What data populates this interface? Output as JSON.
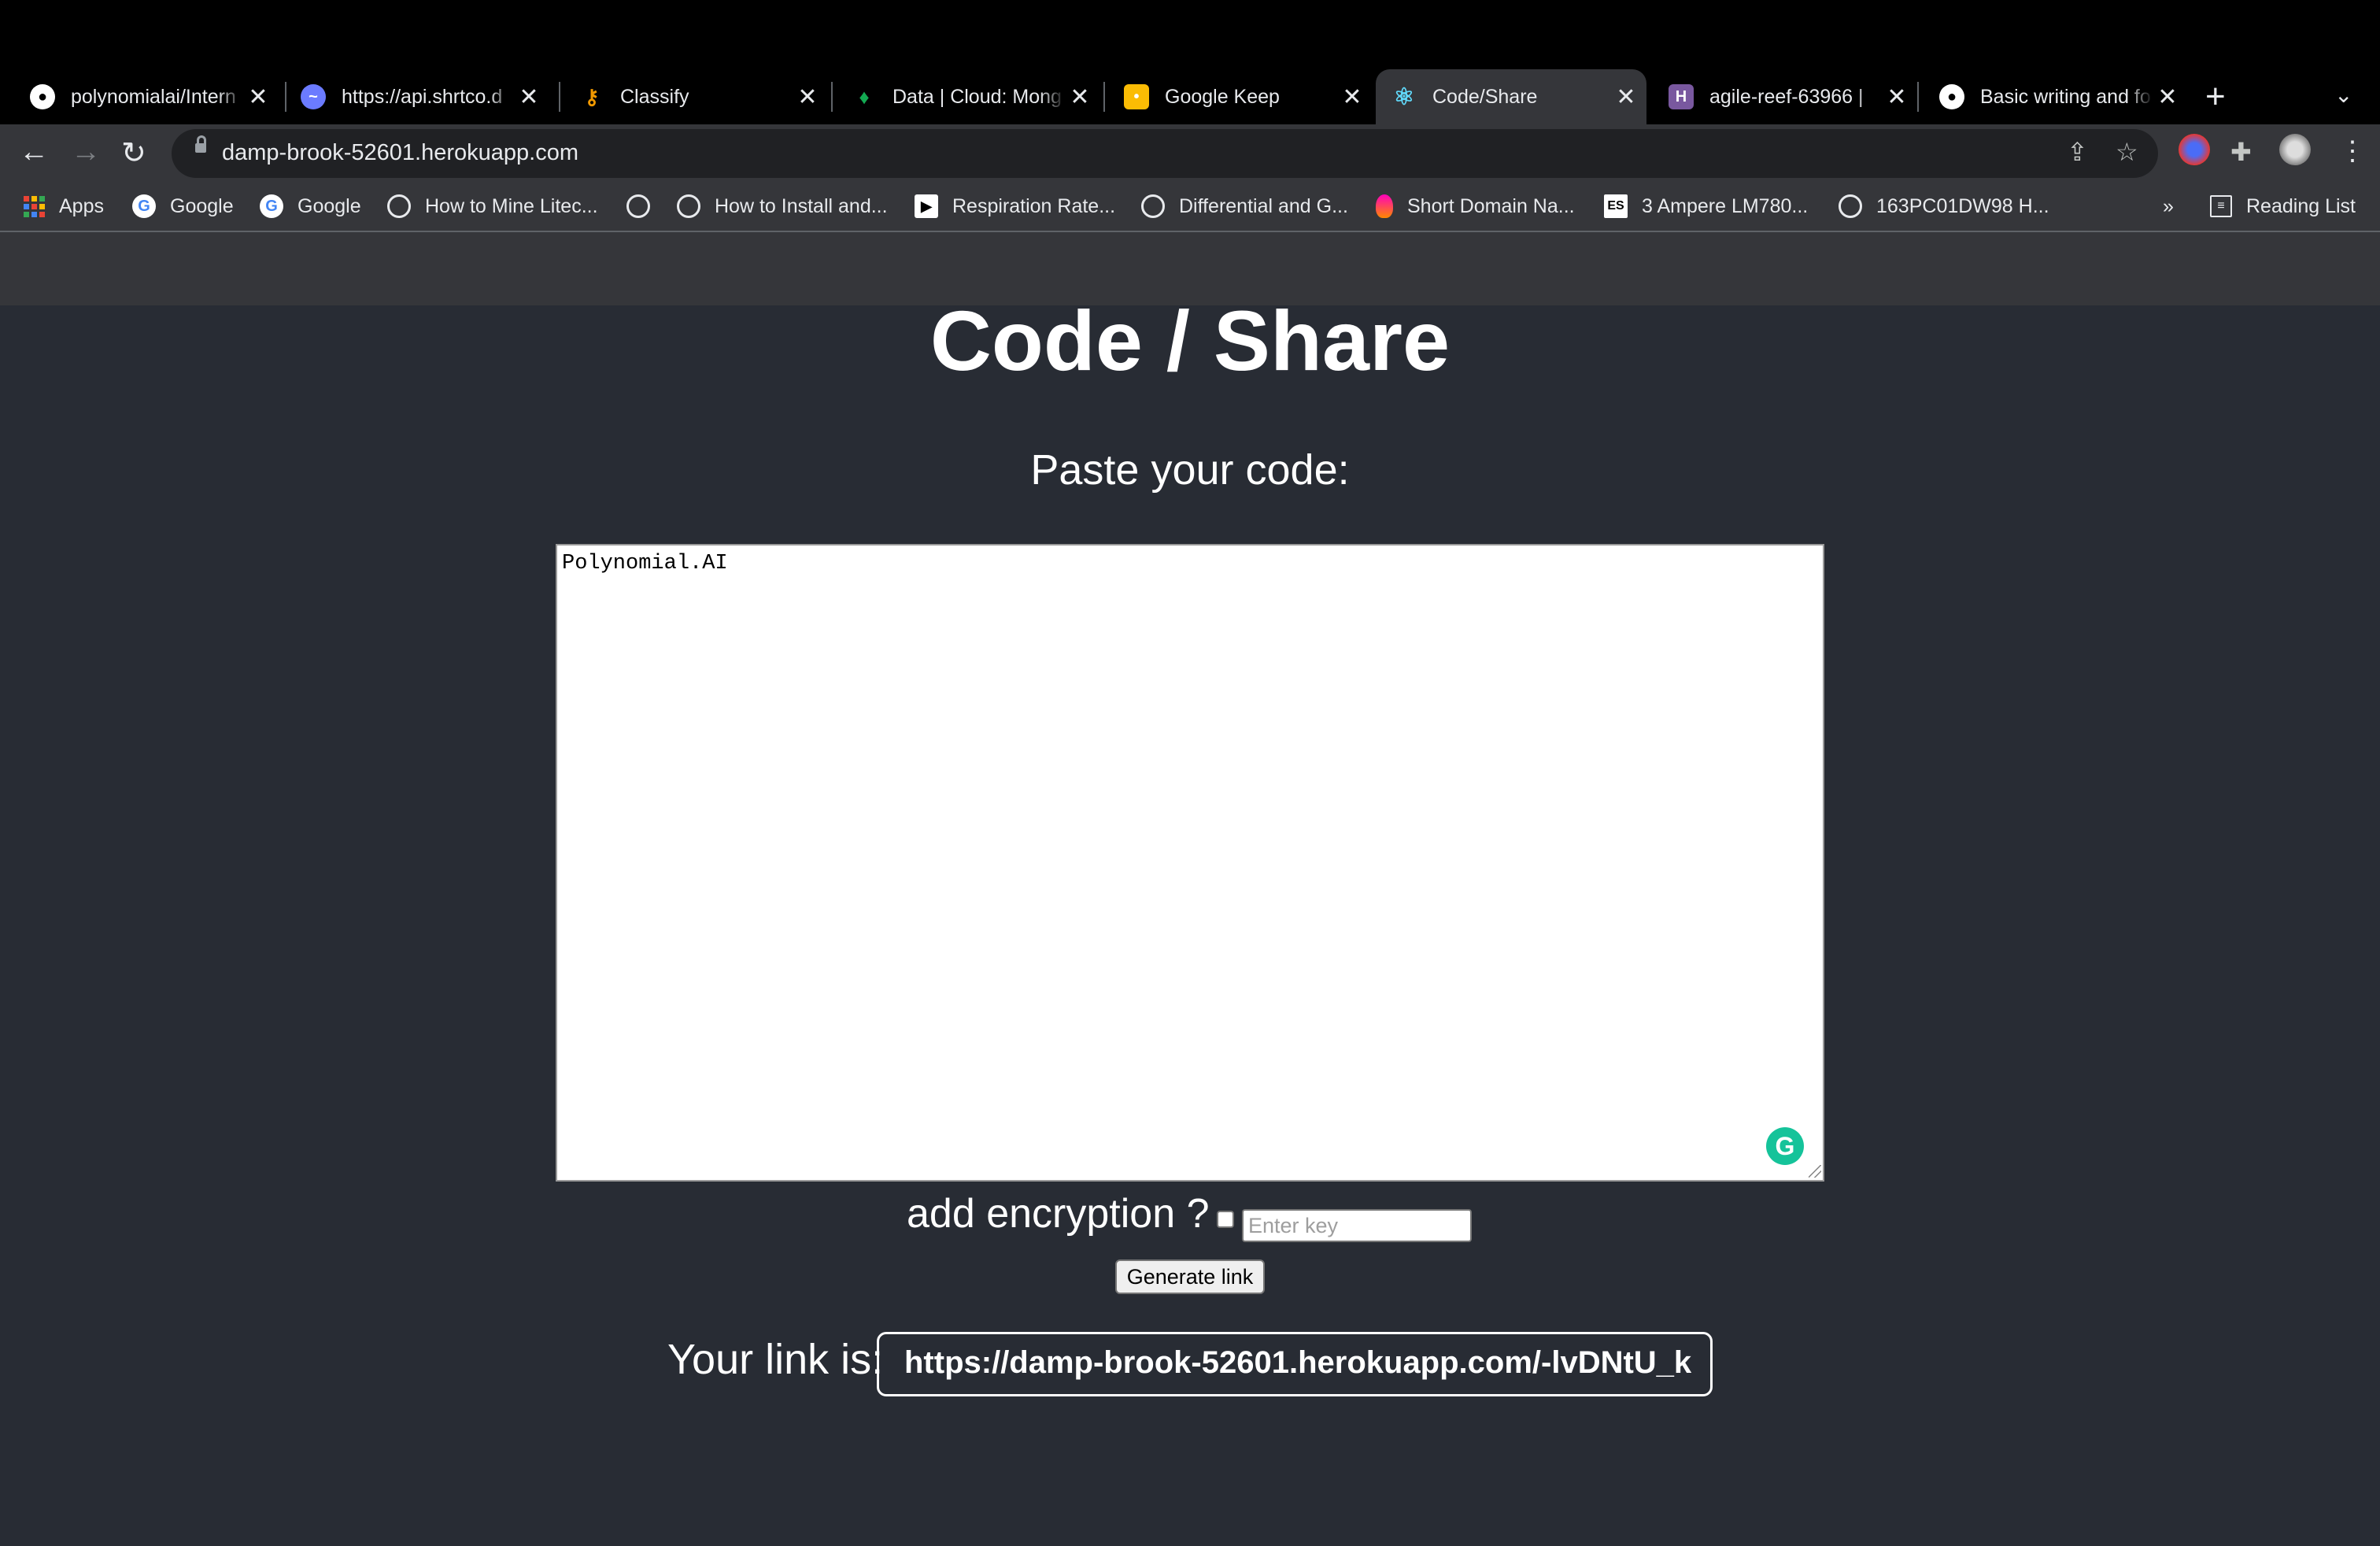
{
  "browser": {
    "tabs": [
      {
        "title": "polynomialai/Intern",
        "icon": "github-icon"
      },
      {
        "title": "https://api.shrtco.d",
        "icon": "shrtco-icon"
      },
      {
        "title": "Classify",
        "icon": "key-icon"
      },
      {
        "title": "Data | Cloud: Mong",
        "icon": "mongodb-leaf-icon"
      },
      {
        "title": "Google Keep",
        "icon": "google-keep-icon"
      },
      {
        "title": "Code/Share",
        "icon": "react-icon",
        "active": true
      },
      {
        "title": "agile-reef-63966 |",
        "icon": "heroku-icon"
      },
      {
        "title": "Basic writing and fo",
        "icon": "github-icon"
      }
    ],
    "address": "damp-brook-52601.herokuapp.com",
    "bookmarks": [
      {
        "label": "Apps",
        "icon": "apps-grid-icon"
      },
      {
        "label": "Google",
        "icon": "google-icon"
      },
      {
        "label": "Google",
        "icon": "google-icon"
      },
      {
        "label": "How to Mine Litec...",
        "icon": "globe-icon"
      },
      {
        "label": "",
        "icon": "globe-icon"
      },
      {
        "label": "How to Install and...",
        "icon": "globe-icon"
      },
      {
        "label": "Respiration Rate...",
        "icon": "play-icon"
      },
      {
        "label": "Differential and G...",
        "icon": "globe-icon"
      },
      {
        "label": "Short Domain Na...",
        "icon": "bitly-icon"
      },
      {
        "label": "3 Ampere LM780...",
        "icon": "es-icon"
      },
      {
        "label": "163PC01DW98 H...",
        "icon": "globe-icon"
      }
    ],
    "overflow_label": "»",
    "reading_list_label": "Reading List"
  },
  "page": {
    "title": "Code / Share",
    "prompt": "Paste your code:",
    "code": "Polynomial.AI",
    "encryption_label": "add encryption ?",
    "key_placeholder": "Enter key",
    "generate_label": "Generate link",
    "link_label": "Your link is:",
    "link_value": "https://damp-brook-52601.herokuapp.com/-lvDNtU_k"
  },
  "colors": {
    "page_background": "#282c34",
    "chrome_dark": "#35363a",
    "grammarly": "#15c39a"
  }
}
